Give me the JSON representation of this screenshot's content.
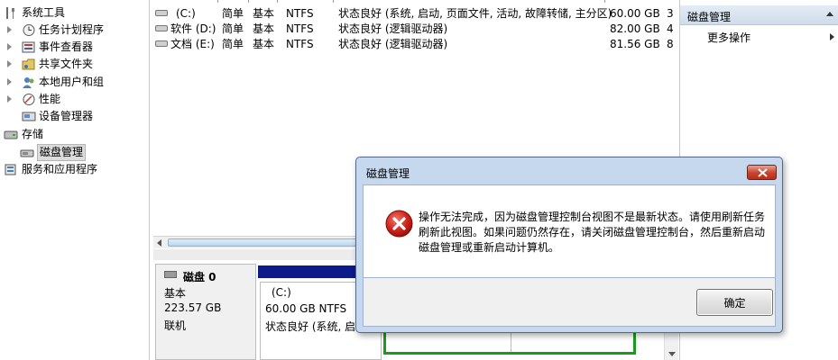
{
  "tree": {
    "items": [
      {
        "label": "系统工具",
        "expanded": true,
        "icon": "tools-icon"
      },
      {
        "label": "任务计划程序",
        "icon": "clock-icon"
      },
      {
        "label": "事件查看器",
        "icon": "event-viewer-icon"
      },
      {
        "label": "共享文件夹",
        "icon": "shared-folder-icon"
      },
      {
        "label": "本地用户和组",
        "icon": "users-icon"
      },
      {
        "label": "性能",
        "icon": "performance-icon"
      },
      {
        "label": "设备管理器",
        "icon": "device-manager-icon"
      },
      {
        "label": "存储",
        "expanded": true,
        "icon": "storage-icon"
      },
      {
        "label": "磁盘管理",
        "selected": true,
        "icon": "disk-management-icon"
      },
      {
        "label": "服务和应用程序",
        "icon": "services-icon"
      }
    ]
  },
  "volumes": [
    {
      "name": "(C:)",
      "layout": "简单",
      "type": "基本",
      "fs": "NTFS",
      "status": "状态良好 (系统, 启动, 页面文件, 活动, 故障转储, 主分区)",
      "capacity": "60.00 GB",
      "more": "3"
    },
    {
      "name": "软件 (D:)",
      "layout": "简单",
      "type": "基本",
      "fs": "NTFS",
      "status": "状态良好 (逻辑驱动器)",
      "capacity": "82.00 GB",
      "more": "4"
    },
    {
      "name": "文档 (E:)",
      "layout": "简单",
      "type": "基本",
      "fs": "NTFS",
      "status": "状态良好 (逻辑驱动器)",
      "capacity": "81.56 GB",
      "more": "8"
    }
  ],
  "disk0": {
    "name": "磁盘 0",
    "type": "基本",
    "size": "223.57 GB",
    "status": "联机",
    "partition_c": {
      "name": "(C:)",
      "size": "60.00 GB NTFS",
      "status": "状态良好 (系统, 启动"
    }
  },
  "actions": {
    "header": "磁盘管理",
    "more": "更多操作"
  },
  "dialog": {
    "title": "磁盘管理",
    "message": "操作无法完成，因为磁盘管理控制台视图不是最新状态。请使用刷新任务刷新此视图。如果问题仍然存在，请关闭磁盘管理控制台，然后重新启动磁盘管理或重新启动计算机。",
    "ok_label": "确定"
  },
  "colors": {
    "disk_bar": "#0c1a8c",
    "logical_border": "#1a9b1a",
    "dialog_frame": "#c6d8ee",
    "error_red": "#d0221b"
  }
}
